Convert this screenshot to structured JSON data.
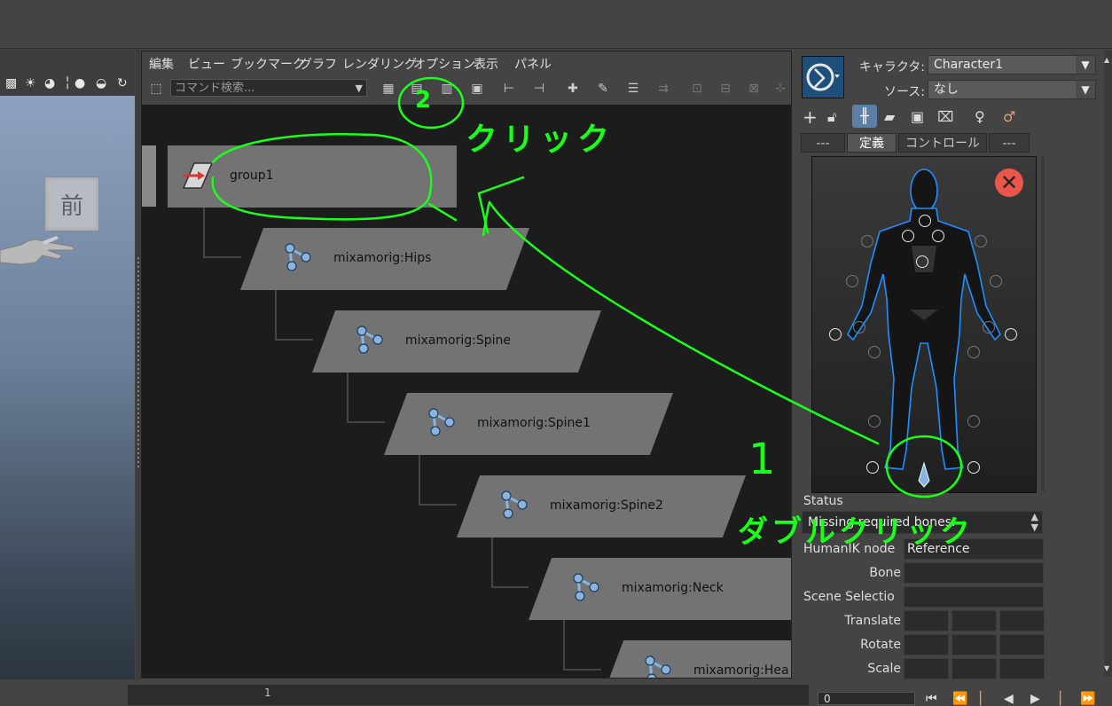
{
  "viewport": {
    "cube_label": "前"
  },
  "node_editor": {
    "menu": [
      "編集",
      "ビュー",
      "ブックマーク",
      "グラフ",
      "レンダリング",
      "オプション",
      "表示",
      "パネル"
    ],
    "search_placeholder": "コマンド検索...",
    "nodes": [
      {
        "label": "group1",
        "type": "transform"
      },
      {
        "label": "mixamorig:Hips",
        "type": "joint"
      },
      {
        "label": "mixamorig:Spine",
        "type": "joint"
      },
      {
        "label": "mixamorig:Spine1",
        "type": "joint"
      },
      {
        "label": "mixamorig:Spine2",
        "type": "joint"
      },
      {
        "label": "mixamorig:Neck",
        "type": "joint"
      },
      {
        "label": "mixamorig:Hea",
        "type": "joint"
      }
    ]
  },
  "humanik": {
    "character_label": "キャラクタ:",
    "character_value": "Character1",
    "source_label": "ソース:",
    "source_value": "なし",
    "tabs": [
      "---",
      "定義",
      "コントロール",
      "---"
    ],
    "active_tab": 1,
    "status_label": "Status",
    "status_value": "Missing required bones.",
    "fields": {
      "humanik_node_label": "HumanIK node",
      "humanik_node_value": "Reference",
      "bone_label": "Bone",
      "scene_selection_label": "Scene Selectio",
      "translate_label": "Translate",
      "rotate_label": "Rotate",
      "scale_label": "Scale"
    }
  },
  "timeline": {
    "ruler_mark": "1",
    "current_frame": "0"
  },
  "annotations": {
    "step1_number": "1",
    "step1_text": "ダブルクリック",
    "step2_number": "2",
    "step2_text": "クリック"
  },
  "colors": {
    "annotation": "#1aff1a",
    "node_fill": "#737373",
    "graph_bg": "#1c1c1c",
    "joint_icon": "#8ab4e0",
    "close_red": "#e8574a"
  }
}
